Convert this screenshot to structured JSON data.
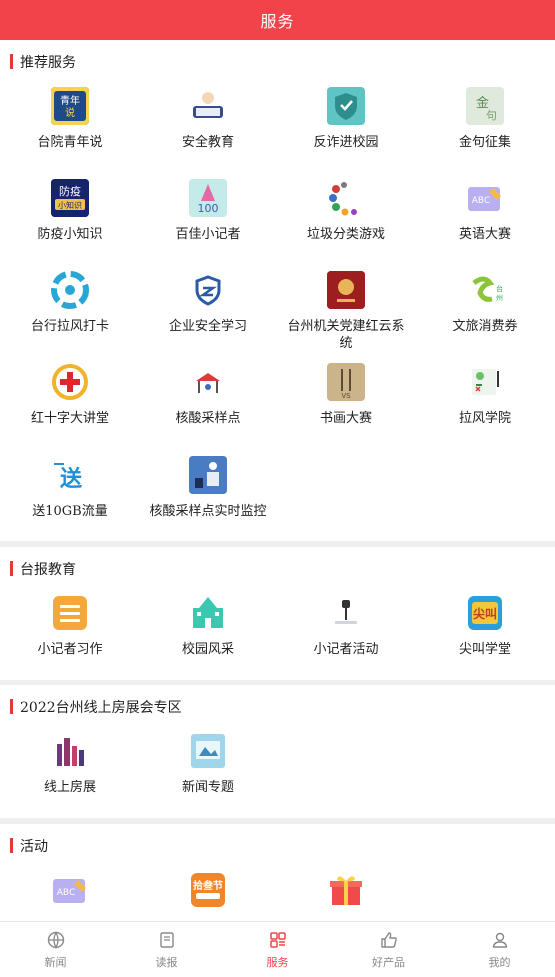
{
  "header": {
    "title": "服务"
  },
  "sections": [
    {
      "title": "推荐服务",
      "items": [
        {
          "label": "台院青年说",
          "icon": "youth-talk-icon"
        },
        {
          "label": "安全教育",
          "icon": "safety-education-icon"
        },
        {
          "label": "反诈进校园",
          "icon": "anti-fraud-shield-icon"
        },
        {
          "label": "金句征集",
          "icon": "golden-quote-icon"
        },
        {
          "label": "防疫小知识",
          "icon": "epidemic-tips-icon"
        },
        {
          "label": "百佳小记者",
          "icon": "top-reporter-icon"
        },
        {
          "label": "垃圾分类游戏",
          "icon": "garbage-sort-icon"
        },
        {
          "label": "英语大赛",
          "icon": "english-contest-icon"
        },
        {
          "label": "台行拉风打卡",
          "icon": "checkin-icon"
        },
        {
          "label": "企业安全学习",
          "icon": "enterprise-safety-icon"
        },
        {
          "label": "台州机关党建红云系统",
          "icon": "party-building-icon"
        },
        {
          "label": "文旅消费券",
          "icon": "travel-voucher-icon"
        },
        {
          "label": "红十字大讲堂",
          "icon": "red-cross-icon"
        },
        {
          "label": "核酸采样点",
          "icon": "nucleic-test-site-icon"
        },
        {
          "label": "书画大赛",
          "icon": "calligraphy-contest-icon"
        },
        {
          "label": "拉风学院",
          "icon": "lafeng-academy-icon"
        },
        {
          "label": "送10GB流量",
          "icon": "free-data-icon"
        },
        {
          "label": "核酸采样点实时监控",
          "icon": "nucleic-monitor-icon"
        }
      ]
    },
    {
      "title": "台报教育",
      "items": [
        {
          "label": "小记者习作",
          "icon": "reporter-writing-icon"
        },
        {
          "label": "校园风采",
          "icon": "campus-style-icon"
        },
        {
          "label": "小记者活动",
          "icon": "reporter-activity-icon"
        },
        {
          "label": "尖叫学堂",
          "icon": "scream-class-icon"
        }
      ]
    },
    {
      "title": "2022台州线上房展会专区",
      "items": [
        {
          "label": "线上房展",
          "icon": "online-house-expo-icon"
        },
        {
          "label": "新闻专题",
          "icon": "news-topic-icon"
        }
      ]
    },
    {
      "title": "活动",
      "items": [
        {
          "label": "",
          "icon": "english-activity-icon"
        },
        {
          "label": "",
          "icon": "festival-activity-icon"
        },
        {
          "label": "",
          "icon": "gift-box-icon"
        }
      ]
    }
  ],
  "tabbar": [
    {
      "label": "新闻",
      "icon": "news-globe-icon",
      "active": false
    },
    {
      "label": "读报",
      "icon": "newspaper-icon",
      "active": false
    },
    {
      "label": "服务",
      "icon": "grid-services-icon",
      "active": true
    },
    {
      "label": "好产品",
      "icon": "thumbs-up-icon",
      "active": false
    },
    {
      "label": "我的",
      "icon": "user-icon",
      "active": false
    }
  ],
  "colors": {
    "brand": "#f2434b",
    "section_bar": "#e23a3a",
    "tab_inactive": "#888888"
  }
}
